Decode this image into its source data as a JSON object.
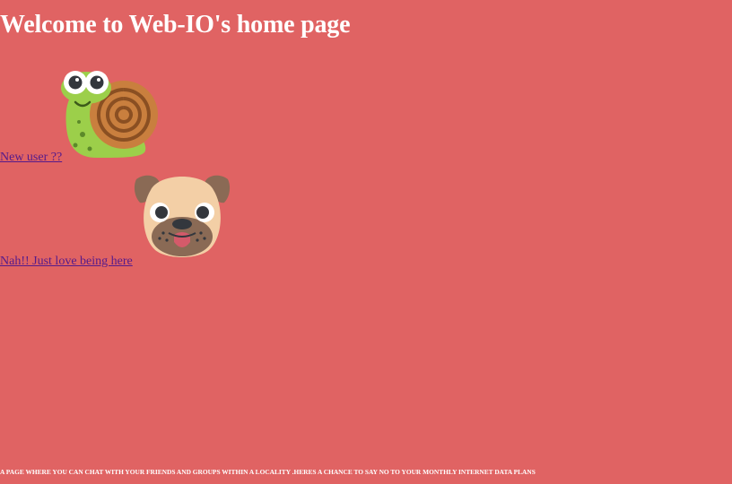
{
  "page": {
    "title": "Welcome to Web-IO's home page"
  },
  "links": {
    "new_user": "New user ??",
    "stay": "Nah!! Just love being here"
  },
  "icons": {
    "snail": "snail-icon",
    "pug": "pug-icon"
  },
  "footer": {
    "text": "A PAGE WHERE YOU CAN CHAT WITH YOUR FRIENDS AND GROUPS WITHIN A LOCALITY .HERES A CHANCE TO SAY NO TO YOUR MONTHLY INTERNET DATA PLANS"
  },
  "colors": {
    "background": "#e06363",
    "heading": "#ffffff",
    "link": "#551a8b"
  }
}
